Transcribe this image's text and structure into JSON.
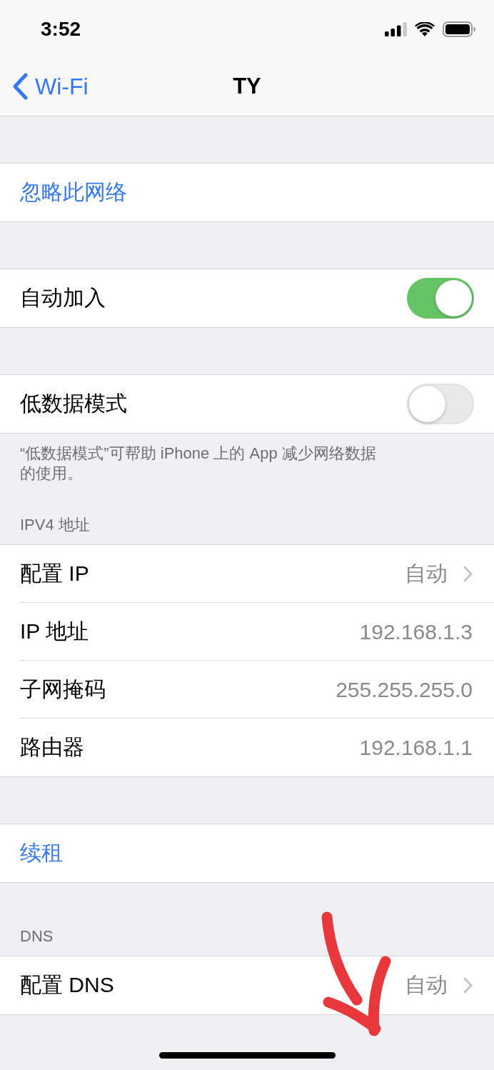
{
  "status_bar": {
    "time": "3:52"
  },
  "nav_bar": {
    "back_label": "Wi-Fi",
    "title": "TY"
  },
  "sections": [
    {
      "rows": [
        {
          "kind": "action",
          "label": "忽略此网络"
        }
      ]
    },
    {
      "rows": [
        {
          "kind": "toggle",
          "label": "自动加入",
          "on": true
        }
      ]
    },
    {
      "rows": [
        {
          "kind": "toggle",
          "label": "低数据模式",
          "on": false
        }
      ],
      "footer": "“低数据模式”可帮助 iPhone 上的 App 减少网络数据的使用。"
    },
    {
      "header": "IPV4 地址",
      "rows": [
        {
          "kind": "link",
          "label": "配置 IP",
          "value": "自动"
        },
        {
          "kind": "value",
          "label": "IP 地址",
          "value": "192.168.1.3"
        },
        {
          "kind": "value",
          "label": "子网掩码",
          "value": "255.255.255.0"
        },
        {
          "kind": "value",
          "label": "路由器",
          "value": "192.168.1.1"
        }
      ]
    },
    {
      "rows": [
        {
          "kind": "action",
          "label": "续租"
        }
      ]
    },
    {
      "header": "DNS",
      "rows": [
        {
          "kind": "link",
          "label": "配置 DNS",
          "value": "自动"
        }
      ]
    }
  ]
}
